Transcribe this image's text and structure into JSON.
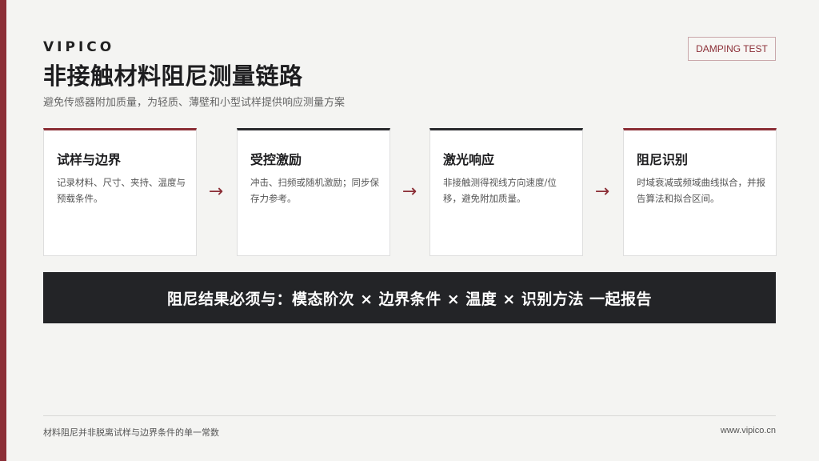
{
  "brand": "VIPICO",
  "title": "非接触材料阻尼测量链路",
  "subtitle": "避免传感器附加质量，为轻质、薄壁和小型试样提供响应测量方案",
  "tag": "DAMPING TEST",
  "cards": [
    {
      "title": "试样与边界",
      "text": "记录材料、尺寸、夹持、温度与预载条件。",
      "accent": "#8b2e36"
    },
    {
      "title": "受控激励",
      "text": "冲击、扫频或随机激励；同步保存力参考。",
      "accent": "#2a2b2e"
    },
    {
      "title": "激光响应",
      "text": "非接触测得视线方向速度/位移，避免附加质量。",
      "accent": "#2a2b2e"
    },
    {
      "title": "阻尼识别",
      "text": "时域衰减或频域曲线拟合，并报告算法和拟合区间。",
      "accent": "#8b2e36"
    }
  ],
  "arrow_glyph": "→",
  "banner": "阻尼结果必须与：模态阶次 × 边界条件 × 温度 × 识别方法 一起报告",
  "footer": {
    "left": "材料阻尼并非脱离试样与边界条件的单一常数",
    "right": "www.vipico.cn"
  },
  "colors": {
    "accent": "#8b2e36",
    "dark": "#232427",
    "background": "#f4f4f2"
  }
}
